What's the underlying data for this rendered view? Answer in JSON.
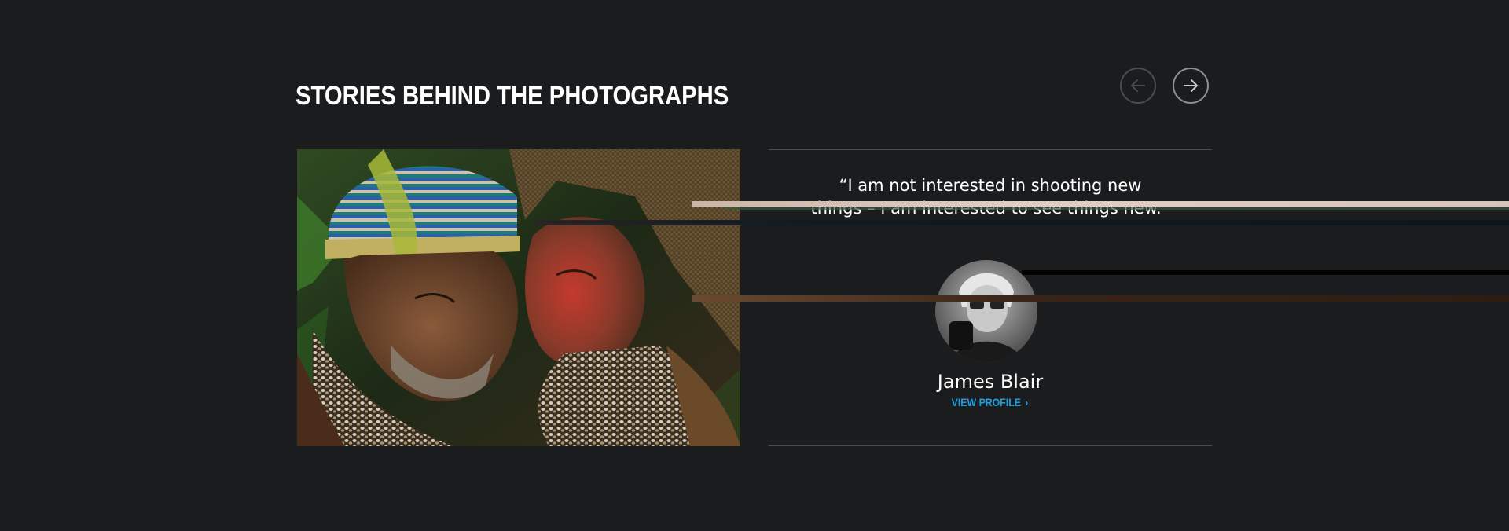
{
  "section": {
    "title": "STORIES BEHIND THE PHOTOGRAPHS"
  },
  "navigation": {
    "prev_icon": "arrow-left-icon",
    "next_icon": "arrow-right-icon"
  },
  "quote": {
    "line1": "“I am not interested in shooting new",
    "line2": "things – I am interested to see things new.”"
  },
  "author": {
    "name": "James Blair",
    "profile_link": "VIEW PROFILE",
    "profile_link_chevron": "›"
  },
  "colors": {
    "background": "#1b1c1e",
    "accent_link": "#1ea0e0",
    "divider": "#4a4b4e",
    "text": "#ffffff"
  }
}
